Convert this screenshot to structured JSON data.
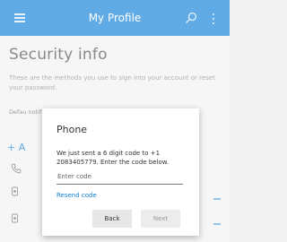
{
  "header": {
    "title": "My Profile",
    "menu_icon": "hamburger-menu-icon",
    "search_icon": "search-icon",
    "more_icon": "more-vertical-icon",
    "bar_color": "#0b7fd8"
  },
  "page": {
    "title": "Security info",
    "description": "These are the methods you use to sign into your account or reset your password.",
    "default_label_visible": "Defau notific",
    "add_method_visible": "+ A",
    "rows": [
      {
        "icon": "phone-icon"
      },
      {
        "icon": "authenticator-icon"
      },
      {
        "icon": "authenticator-icon"
      }
    ]
  },
  "dialog": {
    "title": "Phone",
    "message": "We just sent a 6 digit code to +1 2083405779. Enter the code below.",
    "code_input": {
      "value": "",
      "placeholder": "Enter code"
    },
    "resend_label": "Resend code",
    "back_label": "Back",
    "next_label": "Next"
  }
}
